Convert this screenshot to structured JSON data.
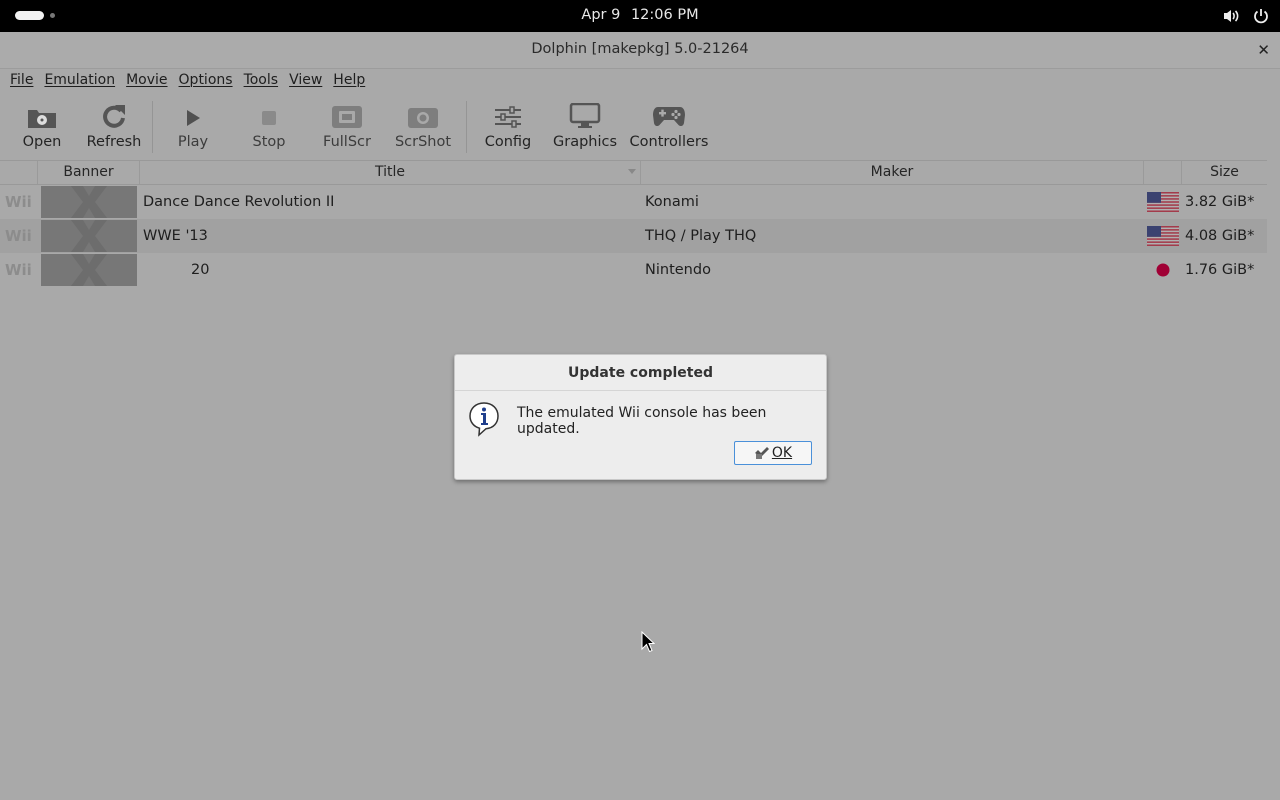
{
  "topbar": {
    "date": "Apr 9",
    "time": "12:06 PM",
    "icons": [
      "activities-icon",
      "volume-icon",
      "power-icon"
    ]
  },
  "window": {
    "title": "Dolphin [makepkg] 5.0-21264",
    "close_glyph": "✕"
  },
  "menu": [
    "File",
    "Emulation",
    "Movie",
    "Options",
    "Tools",
    "View",
    "Help"
  ],
  "toolbar": {
    "open": "Open",
    "refresh": "Refresh",
    "play": "Play",
    "stop": "Stop",
    "fullscr": "FullScr",
    "scrshot": "ScrShot",
    "config": "Config",
    "graphics": "Graphics",
    "controllers": "Controllers"
  },
  "table": {
    "headers": {
      "banner": "Banner",
      "title": "Title",
      "maker": "Maker",
      "size": "Size"
    },
    "rows": [
      {
        "platform": "Wii",
        "title": "Dance Dance Revolution II",
        "maker": "Konami",
        "region": "us-flag-icon",
        "size": "3.82 GiB*"
      },
      {
        "platform": "Wii",
        "title": "WWE '13",
        "maker": "THQ / Play THQ",
        "region": "us-flag-icon",
        "size": "4.08 GiB*"
      },
      {
        "platform": "Wii",
        "title": "20",
        "maker": "Nintendo",
        "region": "jp-flag-icon",
        "size": "1.76 GiB*"
      }
    ]
  },
  "dialog": {
    "title": "Update completed",
    "message": "The emulated Wii console has been updated.",
    "ok_label": "OK"
  },
  "colors": {
    "background": "#a9a9a9",
    "dialog_bg": "#ededed",
    "accent": "#4a90d9",
    "jp_red": "#a00035"
  }
}
